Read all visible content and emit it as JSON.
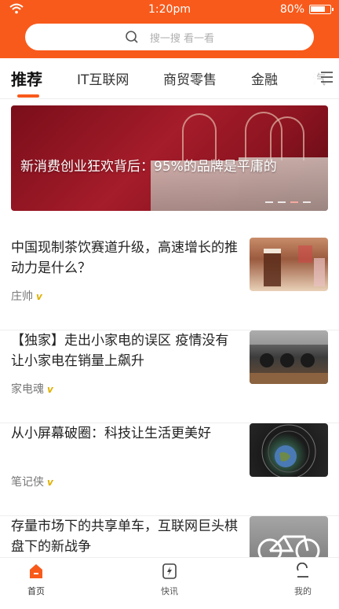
{
  "status_bar": {
    "time": "1:20pm",
    "battery": "80%"
  },
  "search": {
    "placeholder": "搜一搜 看一看"
  },
  "tabs": [
    {
      "label": "推荐",
      "active": true
    },
    {
      "label": "IT互联网",
      "active": false
    },
    {
      "label": "商贸零售",
      "active": false
    },
    {
      "label": "金融",
      "active": false
    },
    {
      "label": "汽",
      "active": false
    }
  ],
  "banner": {
    "title": "新消费创业狂欢背后：95%的品牌是平庸的",
    "page_count": 4,
    "active_page": 3
  },
  "articles": [
    {
      "headline": "中国现制茶饮赛道升级，高速增长的推动力是什么？",
      "author": "庄帅",
      "badge": "v"
    },
    {
      "headline": "【独家】走出小家电的误区 疫情没有让小家电在销量上飙升",
      "author": "家电魂",
      "badge": "v"
    },
    {
      "headline": "从小屏幕破圈：科技让生活更美好",
      "author": "笔记侠",
      "badge": "v"
    },
    {
      "headline": "存量市场下的共享单车，互联网巨头棋盘下的新战争",
      "author": "",
      "badge": ""
    }
  ],
  "bottom_nav": [
    {
      "label": "首页",
      "icon": "home-icon",
      "active": true
    },
    {
      "label": "快讯",
      "icon": "flash-news-icon",
      "active": false
    },
    {
      "label": "我的",
      "icon": "profile-icon",
      "active": false
    }
  ],
  "colors": {
    "accent": "#f85a1b",
    "badge": "#e0b100"
  }
}
